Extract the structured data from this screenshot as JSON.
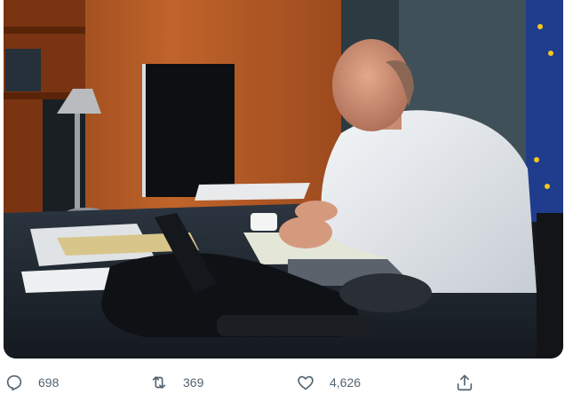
{
  "photo": {
    "alt_icon": "photo-icon"
  },
  "actions": {
    "reply": {
      "icon": "reply-icon",
      "count": "698"
    },
    "retweet": {
      "icon": "retweet-icon",
      "count": "369"
    },
    "like": {
      "icon": "heart-icon",
      "count": "4,626"
    },
    "share": {
      "icon": "share-icon"
    }
  },
  "colors": {
    "action_text": "#536471",
    "background": "#ffffff"
  }
}
